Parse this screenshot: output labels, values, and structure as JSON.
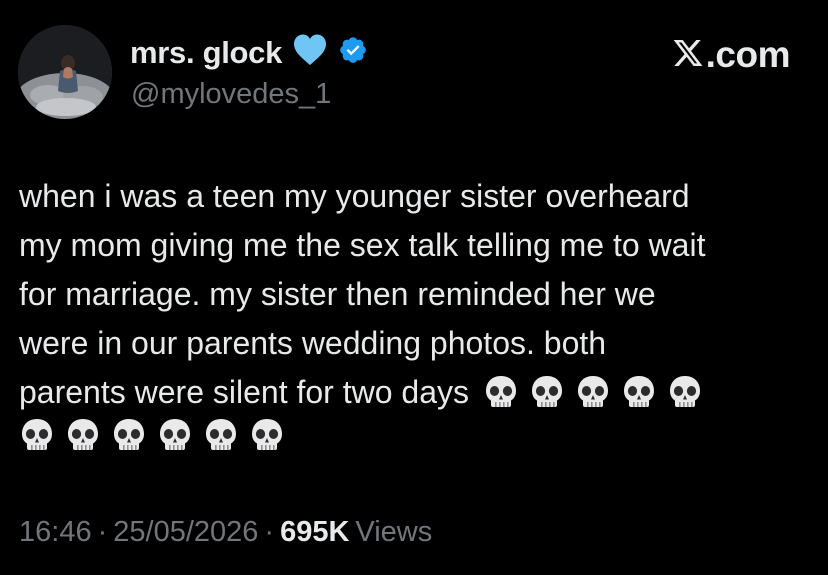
{
  "author": {
    "display_name": "mrs. glock",
    "handle": "@mylovedes_1",
    "heart_icon": "light-blue-heart-icon",
    "verified_icon": "verified-badge-icon"
  },
  "brand": {
    "logo": "x-logo-icon",
    "suffix": ".com"
  },
  "tweet": {
    "line1": "when i was a teen my younger sister overheard",
    "line2": "my mom giving me the sex talk telling me to wait",
    "line3": "for marriage. my sister then reminded her we",
    "line4": "were in our parents wedding photos. both",
    "line5": "parents were silent for two days",
    "skull_emoji_count_line5": 5,
    "skull_emoji_count_line6": 6
  },
  "meta": {
    "time": "16:46",
    "separator1": "·",
    "date": "25/05/2026",
    "separator2": "·",
    "views_count": "695K",
    "views_label": "Views"
  },
  "colors": {
    "background": "#000000",
    "text": "#e7e9ea",
    "secondary": "#71767b",
    "verified": "#1d9bf0",
    "heart": "#6fc6f5"
  }
}
